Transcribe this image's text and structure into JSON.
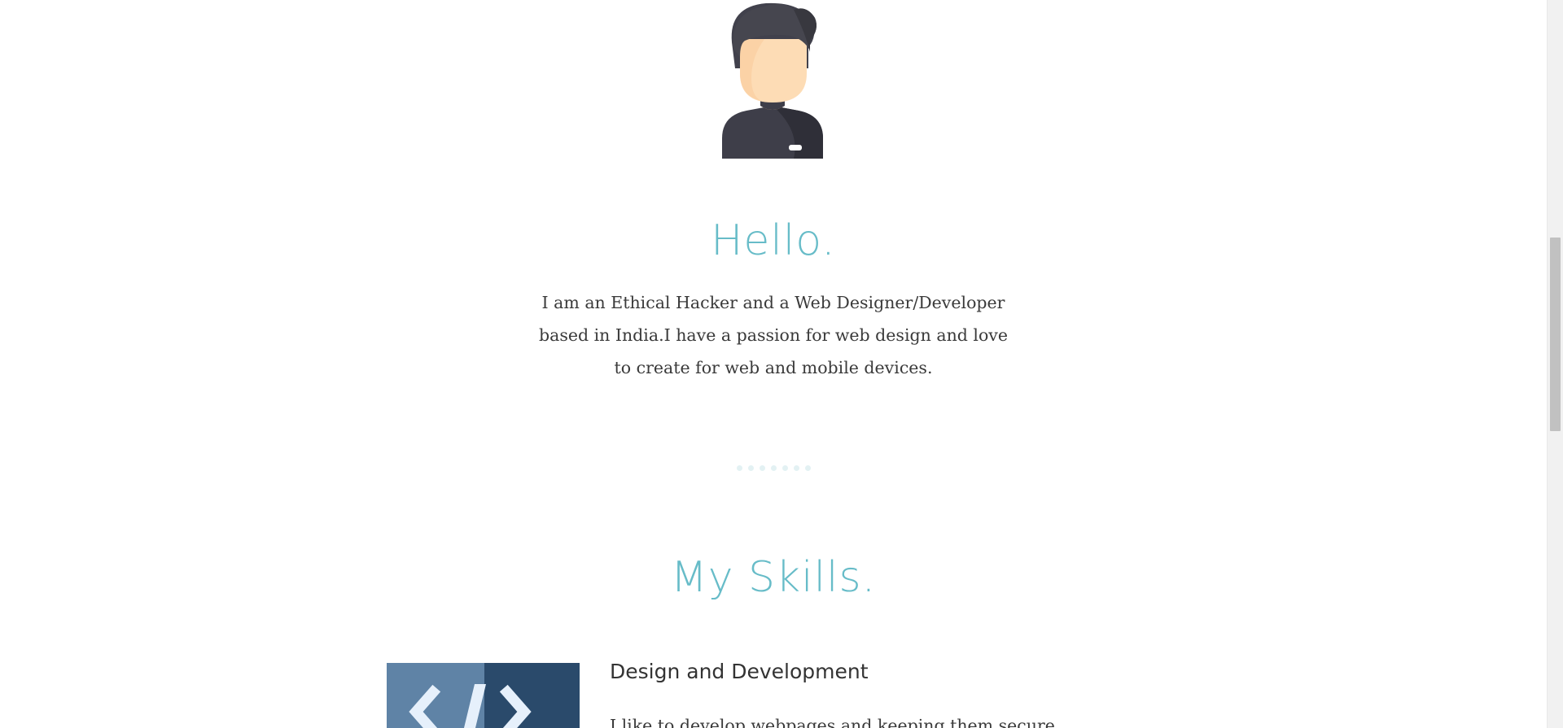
{
  "about": {
    "avatar_icon": "developer-avatar-icon",
    "title": "Hello.",
    "text": "I am an Ethical Hacker and a Web Designer/Developer based in India.I have a passion for web design and love to create for web and mobile devices."
  },
  "divider": {
    "dot_count": 7,
    "dot_color": "#e3f1f3"
  },
  "skills": {
    "title": "My Skills.",
    "items": [
      {
        "icon": "code-icon",
        "heading": "Design and Development",
        "description": "I like to develop webpages and keeping them secure."
      }
    ]
  },
  "theme": {
    "accent": "#67bcc8",
    "text": "#3a3a3a",
    "avatar_hair": "#3f3f4a",
    "avatar_skin": "#fddcb5",
    "code_tile_light": "#5f83a6",
    "code_tile_dark": "#2a4a6b"
  }
}
